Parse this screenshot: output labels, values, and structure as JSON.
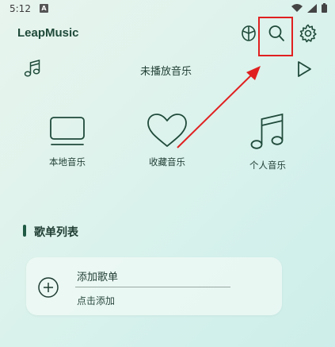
{
  "status_bar": {
    "time": "5:12",
    "notification_badge": "A"
  },
  "header": {
    "title": "LeapMusic"
  },
  "icons": {
    "shuffle": "shuffle-icon",
    "search": "search-icon",
    "settings": "gear-icon",
    "music_note": "music-note-icon",
    "play": "play-icon"
  },
  "now_playing": {
    "text": "未播放音乐"
  },
  "categories": [
    {
      "label": "本地音乐",
      "icon": "monitor-icon"
    },
    {
      "label": "收藏音乐",
      "icon": "heart-icon"
    },
    {
      "label": "个人音乐",
      "icon": "music-notes-icon"
    }
  ],
  "section": {
    "title": "歌单列表"
  },
  "playlist_add": {
    "title": "添加歌单",
    "subtitle": "点击添加"
  },
  "colors": {
    "highlight": "#e02020",
    "accent": "#1f5a45"
  }
}
